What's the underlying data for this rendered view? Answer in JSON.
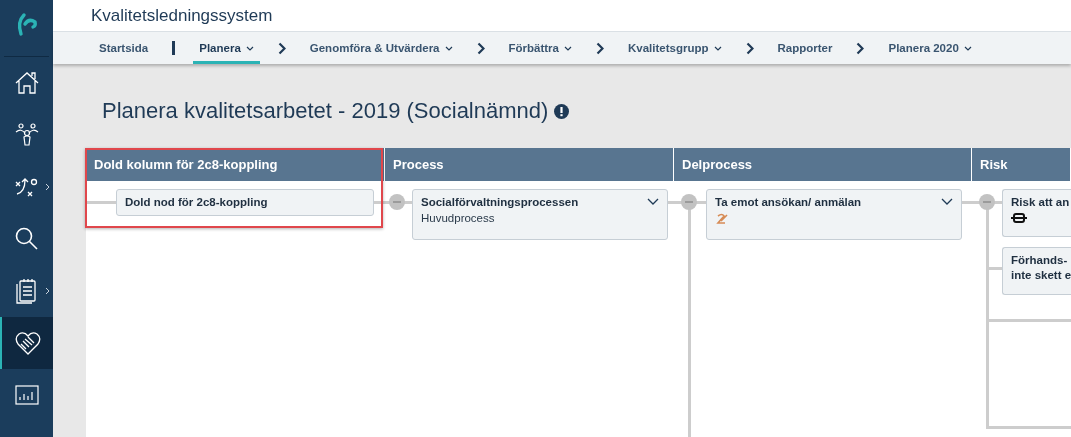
{
  "app": {
    "title": "Kvalitetsledningssystem"
  },
  "sidebar": {
    "items": [
      {
        "kind": "home",
        "selected": false,
        "submenu": false
      },
      {
        "kind": "people",
        "selected": false,
        "submenu": false
      },
      {
        "kind": "strategy",
        "selected": false,
        "submenu": true
      },
      {
        "kind": "search",
        "selected": false,
        "submenu": false
      },
      {
        "kind": "clipboard",
        "selected": false,
        "submenu": true
      },
      {
        "kind": "handshake",
        "selected": true,
        "submenu": false
      },
      {
        "kind": "chart",
        "selected": false,
        "submenu": false
      }
    ]
  },
  "nav": [
    {
      "label": "Startsida",
      "selected": false,
      "dropdown": false,
      "kind": "start"
    },
    {
      "label": "Planera",
      "selected": true,
      "dropdown": true,
      "kind": "bar"
    },
    {
      "label": "Genomföra & Utvärdera",
      "selected": false,
      "dropdown": true,
      "kind": "chevron"
    },
    {
      "label": "Förbättra",
      "selected": false,
      "dropdown": true,
      "kind": "chevron"
    },
    {
      "label": "Kvalitetsgrupp",
      "selected": false,
      "dropdown": true,
      "kind": "chevron"
    },
    {
      "label": "Rapporter",
      "selected": false,
      "dropdown": false,
      "kind": "chevron"
    },
    {
      "label": "Planera 2020",
      "selected": false,
      "dropdown": true,
      "kind": "chevron"
    }
  ],
  "page": {
    "title": "Planera kvalitetsarbetet - 2019 (Socialnämnd)",
    "info": true
  },
  "board": {
    "columns": [
      {
        "title": "Dold kolumn för 2c8-koppling",
        "highlighted": true,
        "nodes": [
          {
            "lines": [
              "Dold nod för 2c8-koppling"
            ],
            "kind": "plain"
          }
        ]
      },
      {
        "title": "Process",
        "highlighted": false,
        "nodes": [
          {
            "lines": [
              "Socialförvaltningsprocessen"
            ],
            "subtitle": "Huvudprocess",
            "kind": "expandable"
          }
        ]
      },
      {
        "title": "Delprocess",
        "highlighted": false,
        "nodes": [
          {
            "lines": [
              "Ta emot ansökan/ anmälan"
            ],
            "kind": "pen"
          }
        ]
      },
      {
        "title": "Risk",
        "highlighted": false,
        "nodes": [
          {
            "lines": [
              "Risk att an"
            ],
            "kind": "link"
          },
          {
            "lines": [
              "Förhands-",
              "inte skett e"
            ],
            "kind": "plain"
          }
        ]
      }
    ]
  }
}
